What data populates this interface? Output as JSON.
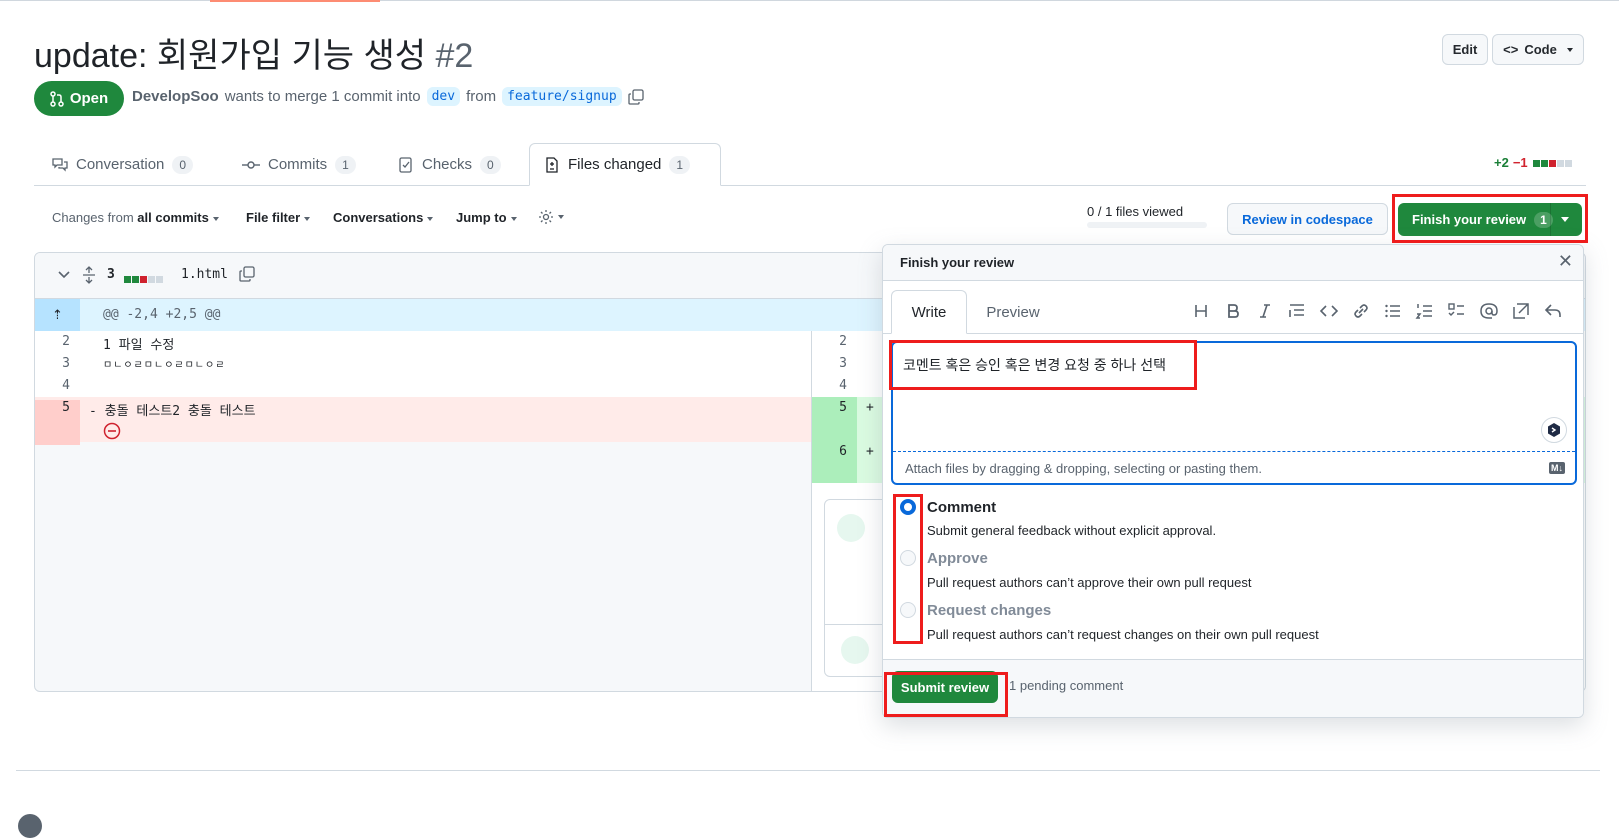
{
  "pr": {
    "title": "update: 회원가입 기능 생성",
    "number": "#2",
    "state": "Open",
    "author": "DevelopSoo",
    "merge_text": "wants to merge 1 commit into",
    "base_branch": "dev",
    "from_text": "from",
    "head_branch": "feature/signup",
    "edit_label": "Edit",
    "code_label": "Code"
  },
  "tabs": [
    {
      "label": "Conversation",
      "count": "0"
    },
    {
      "label": "Commits",
      "count": "1"
    },
    {
      "label": "Checks",
      "count": "0"
    },
    {
      "label": "Files changed",
      "count": "1"
    }
  ],
  "diffstat": {
    "added": "+2",
    "removed": "−1"
  },
  "toolbar": {
    "changes_from": "Changes from",
    "all_commits": "all commits",
    "file_filter": "File filter",
    "conversations": "Conversations",
    "jump_to": "Jump to",
    "files_viewed": "0 / 1 files viewed",
    "review_codespace": "Review in codespace",
    "finish_review": "Finish your review",
    "finish_count": "1"
  },
  "file": {
    "changes": "3",
    "name": "1.html",
    "hunk": "@@ -2,4 +2,5 @@",
    "left_lines": [
      {
        "num": "2",
        "text": "1 파일 수정"
      },
      {
        "num": "3",
        "text": "ㅁㄴㅇㄹㅁㄴㅇㄹㅁㄴㅇㄹ"
      },
      {
        "num": "4",
        "text": ""
      },
      {
        "num": "5",
        "text": "- 충돌 테스트2 충돌 테스트"
      }
    ],
    "right_lines": [
      {
        "num": "2",
        "text": ""
      },
      {
        "num": "3",
        "text": ""
      },
      {
        "num": "4",
        "text": ""
      },
      {
        "num": "5",
        "text": "+"
      },
      {
        "num": "6",
        "text": "+"
      }
    ]
  },
  "review": {
    "header": "Finish your review",
    "write_tab": "Write",
    "preview_tab": "Preview",
    "comment_text": "코멘트 혹은 승인 혹은 변경 요청 중 하나 선택",
    "attach_hint": "Attach files by dragging & dropping, selecting or pasting them.",
    "markdown_badge": "M↓",
    "options": [
      {
        "label": "Comment",
        "desc": "Submit general feedback without explicit approval.",
        "checked": true,
        "disabled": false
      },
      {
        "label": "Approve",
        "desc": "Pull request authors can’t approve their own pull request",
        "checked": false,
        "disabled": true
      },
      {
        "label": "Request changes",
        "desc": "Pull request authors can’t request changes on their own pull request",
        "checked": false,
        "disabled": true
      }
    ],
    "submit_label": "Submit review",
    "pending_text": "1 pending comment"
  },
  "colors": {
    "primary_green": "#1f883d",
    "accent_blue": "#0969da",
    "annotation_red": "#ee1c1c",
    "deletion_bg": "#ffebe9",
    "addition_bg": "#dafbe1"
  }
}
